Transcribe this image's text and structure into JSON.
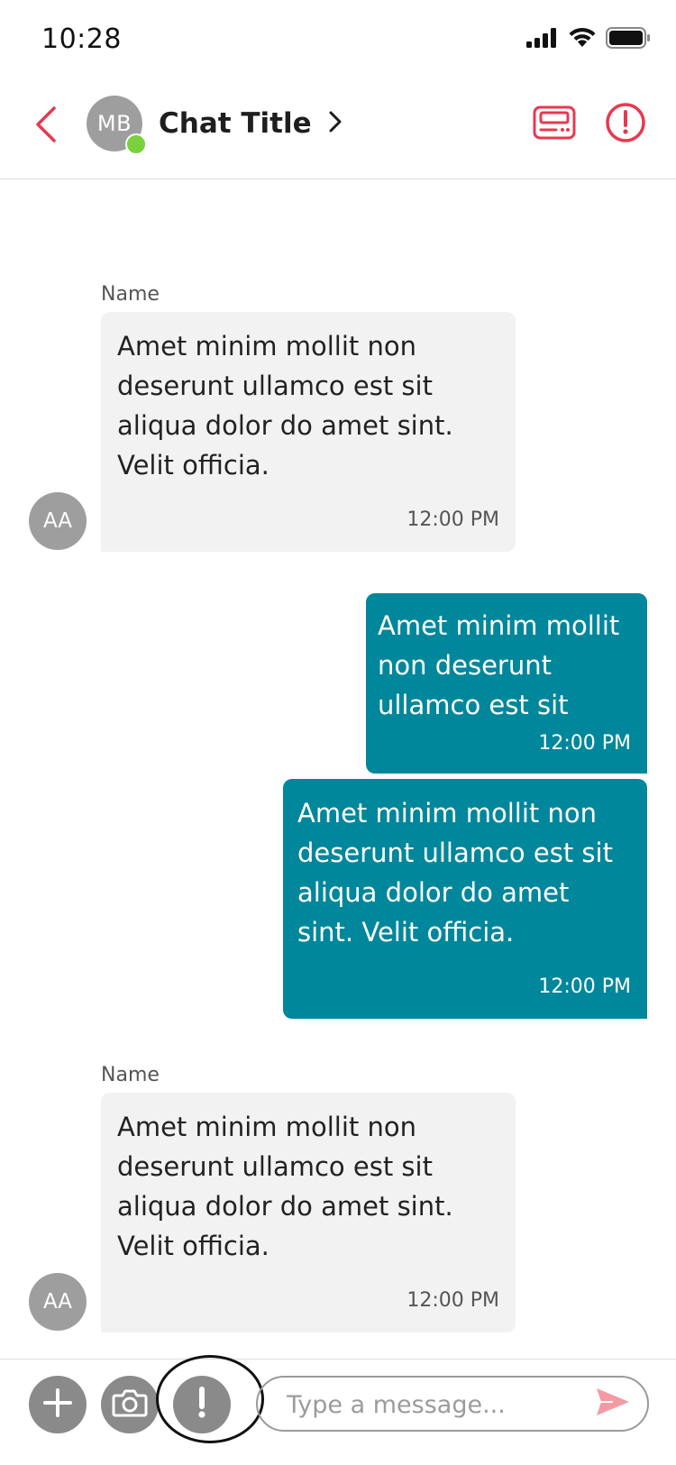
{
  "status_bar": {
    "time": "10:28",
    "icons": [
      "signal-icon",
      "wifi-icon",
      "battery-icon"
    ]
  },
  "header": {
    "avatar_initials": "MB",
    "online": true,
    "title": "Chat Title",
    "icons": [
      "back-chevron-icon",
      "chevron-right-icon",
      "pager-icon",
      "alert-circle-icon"
    ]
  },
  "messages": [
    {
      "direction": "incoming",
      "sender_name": "Name",
      "avatar_initials": "AA",
      "lines": [
        "Amet minim mollit non",
        "deserunt ullamco est sit",
        "aliqua dolor do amet sint.",
        "Velit officia."
      ],
      "time": "12:00 PM"
    },
    {
      "direction": "outgoing",
      "lines": [
        "Amet minim mollit",
        "non deserunt",
        "ullamco est sit"
      ],
      "time": "12:00 PM"
    },
    {
      "direction": "outgoing",
      "lines": [
        "Amet minim mollit non",
        "deserunt ullamco est sit",
        "aliqua dolor do amet",
        "sint. Velit officia."
      ],
      "time": "12:00 PM"
    },
    {
      "direction": "incoming",
      "sender_name": "Name",
      "avatar_initials": "AA",
      "lines": [
        "Amet minim mollit non",
        "deserunt ullamco est sit",
        "aliqua dolor do amet sint.",
        "Velit officia."
      ],
      "time": "12:00 PM"
    }
  ],
  "composer": {
    "placeholder": "Type a message...",
    "value": "",
    "icons": [
      "plus-icon",
      "camera-icon",
      "exclamation-icon",
      "send-icon"
    ]
  },
  "colors": {
    "accent": "#e8384f",
    "outgoing_bubble": "#00879b",
    "incoming_bubble": "#f2f2f2",
    "avatar_gray": "#9e9e9e",
    "online": "#7ad13c",
    "send_icon": "#f59aa5"
  }
}
